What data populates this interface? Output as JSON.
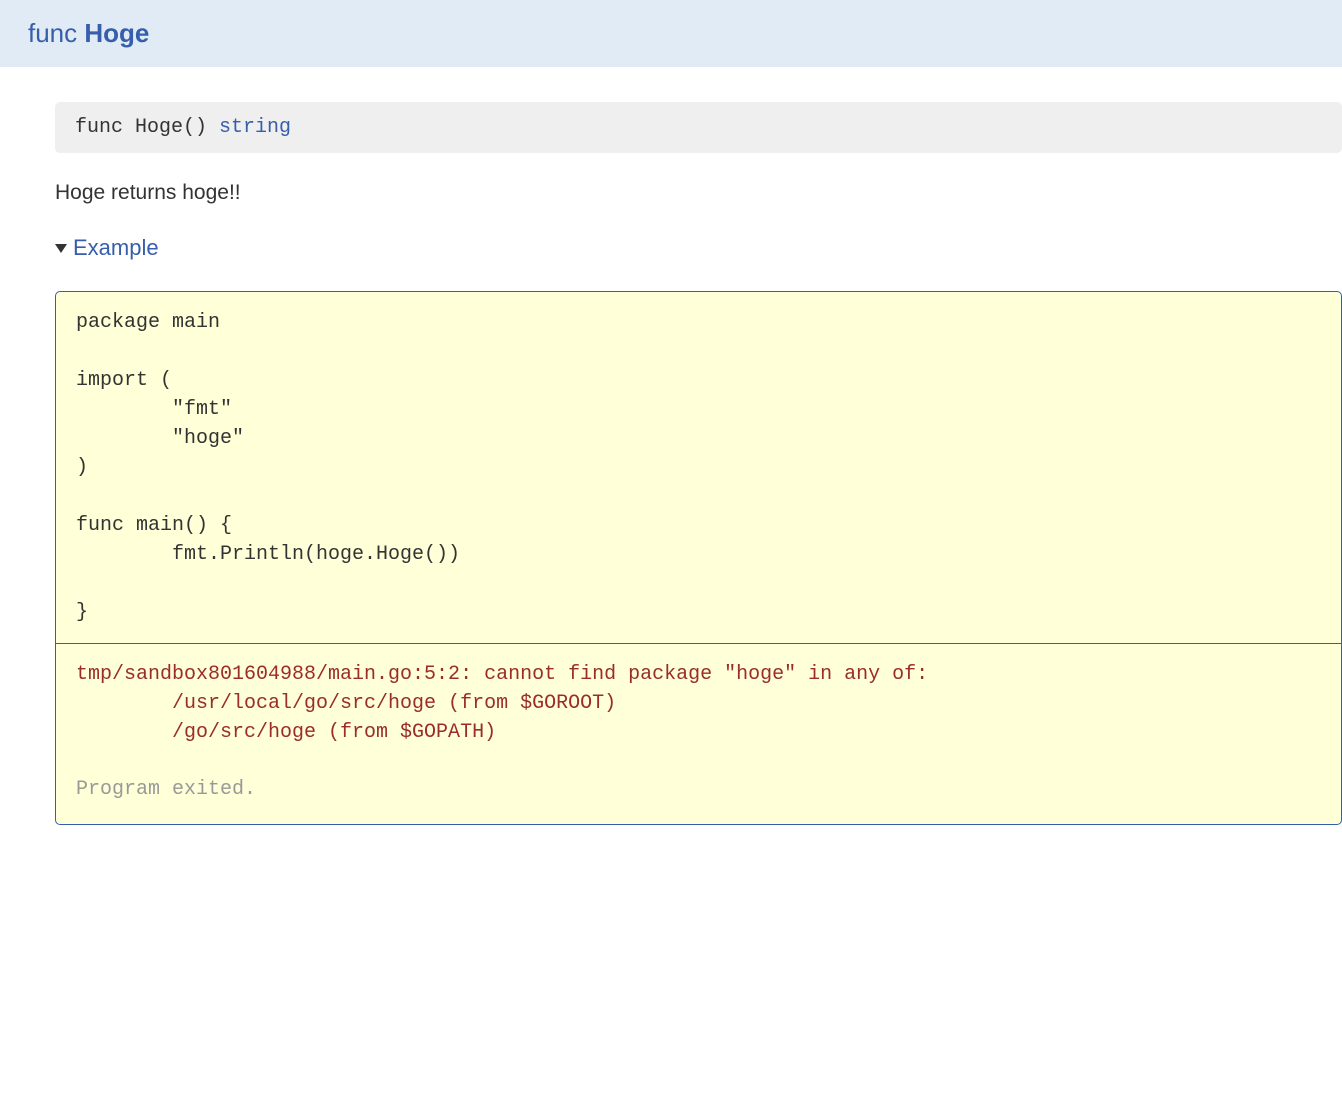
{
  "header": {
    "func_keyword": "func",
    "func_name": "Hoge"
  },
  "signature": {
    "prefix": "func Hoge() ",
    "return_type": "string"
  },
  "description": "Hoge returns hoge!!",
  "example_label": "Example",
  "code": "package main\n\nimport (\n        \"fmt\"\n        \"hoge\"\n)\n\nfunc main() {\n        fmt.Println(hoge.Hoge())\n\n}\n",
  "output": {
    "error": "tmp/sandbox801604988/main.go:5:2: cannot find package \"hoge\" in any of:\n        /usr/local/go/src/hoge (from $GOROOT)\n        /go/src/hoge (from $GOPATH)",
    "status": "Program exited."
  }
}
